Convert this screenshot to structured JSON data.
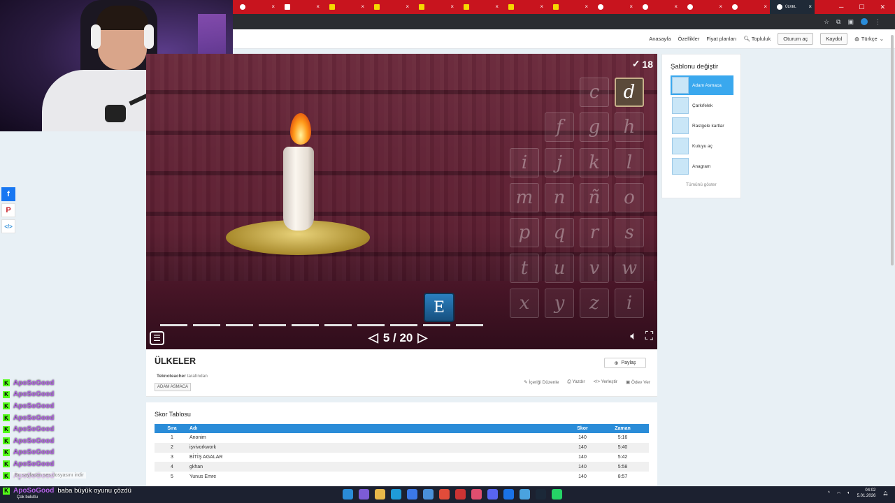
{
  "browser": {
    "tabs": [
      {
        "label": "",
        "icon": "chrome-icon"
      },
      {
        "label": "",
        "icon": "youtube-icon"
      },
      {
        "label": "",
        "icon": "s-icon"
      },
      {
        "label": "",
        "icon": "s-icon"
      },
      {
        "label": "",
        "icon": "s-icon"
      },
      {
        "label": "",
        "icon": "s-icon"
      },
      {
        "label": "",
        "icon": "s-icon"
      },
      {
        "label": "",
        "icon": "s-icon"
      },
      {
        "label": "",
        "icon": "chrome-icon"
      },
      {
        "label": "",
        "icon": "chrome-icon"
      },
      {
        "label": "",
        "icon": "chrome-icon"
      },
      {
        "label": "",
        "icon": "chrome-icon"
      },
      {
        "label": "ÜLKEL",
        "icon": "wordwall-icon",
        "active": true
      }
    ]
  },
  "header": {
    "nav": [
      "Anasayfa",
      "Özellikler",
      "Fiyat planları"
    ],
    "community": "Topluluk",
    "login": "Oturum aç",
    "signup": "Kaydol",
    "language": "Türkçe"
  },
  "game": {
    "score": "18",
    "page_current": "5",
    "page_total": "20",
    "page_text": "5 / 20",
    "revealed_letter": "E",
    "blank_count": 10,
    "keyboard": [
      {
        "k": "c",
        "used": false
      },
      {
        "k": "d",
        "used": true
      },
      {
        "k": "f",
        "used": false
      },
      {
        "k": "g",
        "used": false
      },
      {
        "k": "h",
        "used": false
      },
      {
        "k": "i",
        "used": false
      },
      {
        "k": "j",
        "used": false
      },
      {
        "k": "k",
        "used": false
      },
      {
        "k": "l",
        "used": false
      },
      {
        "k": "m",
        "used": false
      },
      {
        "k": "n",
        "used": false
      },
      {
        "k": "ñ",
        "used": false
      },
      {
        "k": "o",
        "used": false
      },
      {
        "k": "p",
        "used": false
      },
      {
        "k": "q",
        "used": false
      },
      {
        "k": "r",
        "used": false
      },
      {
        "k": "s",
        "used": false
      },
      {
        "k": "t",
        "used": false
      },
      {
        "k": "u",
        "used": false
      },
      {
        "k": "v",
        "used": false
      },
      {
        "k": "w",
        "used": false
      },
      {
        "k": "x",
        "used": false
      },
      {
        "k": "y",
        "used": false
      },
      {
        "k": "z",
        "used": false
      },
      {
        "k": "i",
        "used": false
      }
    ]
  },
  "templates": {
    "title": "Şablonu değiştir",
    "items": [
      "Adam Asmaca",
      "Çarkıfelek",
      "Rastgele kartlar",
      "Kutuyu aç",
      "Anagram"
    ],
    "show_all": "Tümünü göster"
  },
  "activity": {
    "title": "ÜLKELER",
    "author": "Teknoteacher",
    "author_suffix": "tarafından",
    "tag": "ADAM ASMACA",
    "share": "Paylaş",
    "actions": [
      "İçeriği Düzenle",
      "Yazdır",
      "Yerleştir",
      "Ödev Ver"
    ]
  },
  "scoreboard": {
    "title": "Skor Tablosu",
    "headers": [
      "Sıra",
      "Adı",
      "Skor",
      "Zaman"
    ],
    "rows": [
      [
        "1",
        "Anonim",
        "140",
        "5:16"
      ],
      [
        "2",
        "işvivorkwork",
        "140",
        "5:40"
      ],
      [
        "3",
        "BİTİŞ AGALAR",
        "140",
        "5:42"
      ],
      [
        "4",
        "gkhan",
        "140",
        "5:58"
      ],
      [
        "5",
        "Yunus Emre",
        "140",
        "8:57"
      ]
    ]
  },
  "chat": {
    "user": "ApoSoGood",
    "repeated_rows": 9,
    "last_message": "baba büyük oyunu çözdü",
    "download_notice": "Bu sayfadan ses dosyasını indir",
    "status": "Çok bulutlu"
  },
  "tray": {
    "time": "04:02",
    "date": "5.01.2026"
  }
}
